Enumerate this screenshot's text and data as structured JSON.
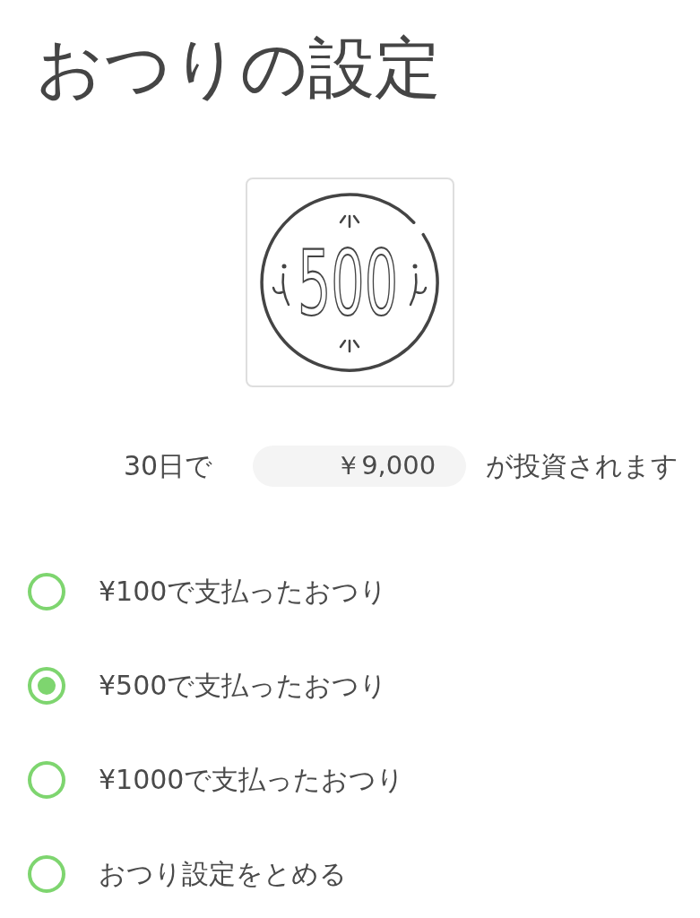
{
  "title": "おつりの設定",
  "coin": {
    "label": "500"
  },
  "investment": {
    "prefix": "30日で",
    "amount": "￥9,000",
    "suffix": "が投資されます"
  },
  "options": [
    {
      "label": "¥100で支払ったおつり",
      "selected": false
    },
    {
      "label": "¥500で支払ったおつり",
      "selected": true
    },
    {
      "label": "¥1000で支払ったおつり",
      "selected": false
    },
    {
      "label": "おつり設定をとめる",
      "selected": false
    }
  ]
}
